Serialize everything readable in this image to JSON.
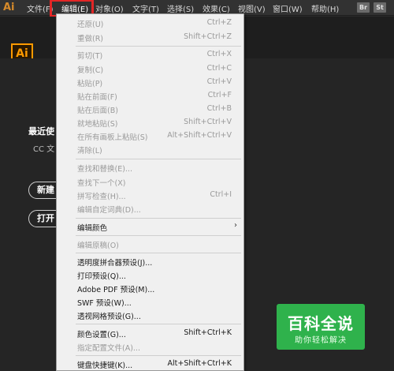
{
  "menubar": {
    "logo": "Ai",
    "items": [
      "文件(F)",
      "编辑(E)",
      "对象(O)",
      "文字(T)",
      "选择(S)",
      "效果(C)",
      "视图(V)",
      "窗口(W)",
      "帮助(H)"
    ],
    "switchers": [
      "Br",
      "St"
    ],
    "active_index": 1,
    "highlight_color": "#e32626"
  },
  "home": {
    "app_logo": "Ai",
    "recent_title": "最近使",
    "recent_sub": "CC 文",
    "buttons": [
      "新建",
      "打开"
    ]
  },
  "edit_menu": {
    "items": [
      {
        "label": "还原(U)",
        "shortcut": "Ctrl+Z",
        "enabled": false
      },
      {
        "label": "重做(R)",
        "shortcut": "Shift+Ctrl+Z",
        "enabled": false
      },
      {
        "label": "剪切(T)",
        "shortcut": "Ctrl+X",
        "enabled": false
      },
      {
        "label": "复制(C)",
        "shortcut": "Ctrl+C",
        "enabled": false
      },
      {
        "label": "粘贴(P)",
        "shortcut": "Ctrl+V",
        "enabled": false
      },
      {
        "label": "贴在前面(F)",
        "shortcut": "Ctrl+F",
        "enabled": false
      },
      {
        "label": "贴在后面(B)",
        "shortcut": "Ctrl+B",
        "enabled": false
      },
      {
        "label": "就地粘贴(S)",
        "shortcut": "Shift+Ctrl+V",
        "enabled": false
      },
      {
        "label": "在所有画板上粘贴(S)",
        "shortcut": "Alt+Shift+Ctrl+V",
        "enabled": false
      },
      {
        "label": "清除(L)",
        "shortcut": "",
        "enabled": false
      },
      {
        "label": "查找和替换(E)...",
        "shortcut": "",
        "enabled": false
      },
      {
        "label": "查找下一个(X)",
        "shortcut": "",
        "enabled": false
      },
      {
        "label": "拼写检查(H)...",
        "shortcut": "Ctrl+I",
        "enabled": false
      },
      {
        "label": "编辑自定词典(D)...",
        "shortcut": "",
        "enabled": false
      },
      {
        "label": "编辑颜色",
        "shortcut": "",
        "enabled": true,
        "submenu": true
      },
      {
        "label": "编辑原稿(O)",
        "shortcut": "",
        "enabled": false
      },
      {
        "label": "透明度拼合器预设(J)...",
        "shortcut": "",
        "enabled": true
      },
      {
        "label": "打印预设(Q)...",
        "shortcut": "",
        "enabled": true
      },
      {
        "label": "Adobe PDF 预设(M)...",
        "shortcut": "",
        "enabled": true
      },
      {
        "label": "SWF 预设(W)...",
        "shortcut": "",
        "enabled": true
      },
      {
        "label": "透视网格预设(G)...",
        "shortcut": "",
        "enabled": true
      },
      {
        "label": "颜色设置(G)...",
        "shortcut": "Shift+Ctrl+K",
        "enabled": true
      },
      {
        "label": "指定配置文件(A)...",
        "shortcut": "",
        "enabled": false
      },
      {
        "label": "键盘快捷键(K)...",
        "shortcut": "Alt+Shift+Ctrl+K",
        "enabled": true
      }
    ],
    "submenu_arrow": "›"
  },
  "watermark": {
    "title": "百科全说",
    "subtitle": "助你轻松解决",
    "color": "#2fb24c"
  }
}
